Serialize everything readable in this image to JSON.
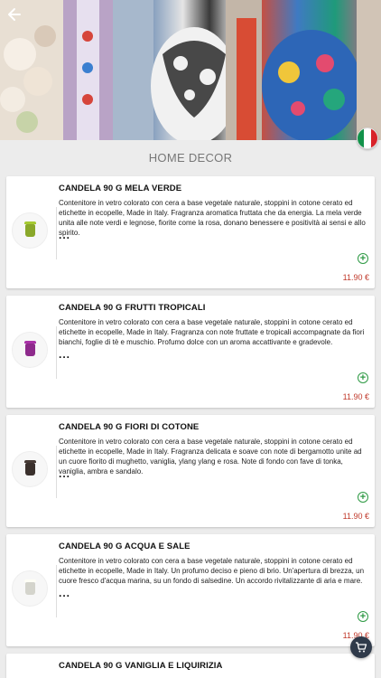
{
  "header": {
    "back_icon": "arrow-left-icon",
    "language_flag": "italy-flag-icon"
  },
  "section": {
    "title": "HOME DECOR"
  },
  "products": [
    {
      "name": "CANDELA 90 G MELA VERDE",
      "description": "Contenitore in vetro colorato con cera a base vegetale naturale, stoppini in cotone cerato ed etichette in ecopelle, Made in Italy. Fragranza aromatica fruttata che da energia. La mela verde unita alle note verdi e  legnose, fiorite come la rosa, donano benessere e positività ai sensi e allo spirito.",
      "more": "...",
      "price": "11.90 €",
      "color": "#8aa82a"
    },
    {
      "name": "CANDELA 90 G FRUTTI TROPICALI",
      "description": "Contenitore in vetro colorato con cera a base vegetale naturale, stoppini in cotone cerato ed etichette in ecopelle, Made in Italy. Fragranza con note fruttate e tropicali accompagnate da fiori bianchi, foglie di tè e  muschio. Profumo dolce con un aroma accattivante e gradevole.",
      "more": "...",
      "price": "11.90 €",
      "color": "#8e2a8c"
    },
    {
      "name": "CANDELA 90 G FIORI DI COTONE",
      "description": "Contenitore in vetro colorato con cera a base vegetale naturale, stoppini in cotone cerato ed etichette in ecopelle, Made in Italy. Fragranza delicata e soave con note di bergamotto unite ad un cuore fiorito di mughetto, vaniglia, ylang ylang e rosa. Note di fondo con fave di tonka, vaniglia, ambra e sandalo.",
      "more": "...",
      "price": "11.90 €",
      "color": "#3a302c"
    },
    {
      "name": "CANDELA 90 G ACQUA E SALE",
      "description": "Contenitore in vetro colorato con cera a base vegetale naturale, stoppini in cotone cerato ed etichette in ecopelle, Made in Italy. Un profumo deciso e pieno di brio. Un'apertura di brezza, un cuore fresco d'acqua  marina, su un fondo di salsedine. Un accordo rivitalizzante di aria e mare.",
      "more": "...",
      "price": "11.90 €",
      "color": "#d4d4cc"
    }
  ],
  "partial_product": {
    "name": "CANDELA 90 G VANIGLIA E LIQUIRIZIA"
  },
  "cart": {
    "icon": "cart-icon"
  },
  "colors": {
    "price": "#c0392b",
    "add": "#2e9a44",
    "fab": "#2f3a4a"
  }
}
